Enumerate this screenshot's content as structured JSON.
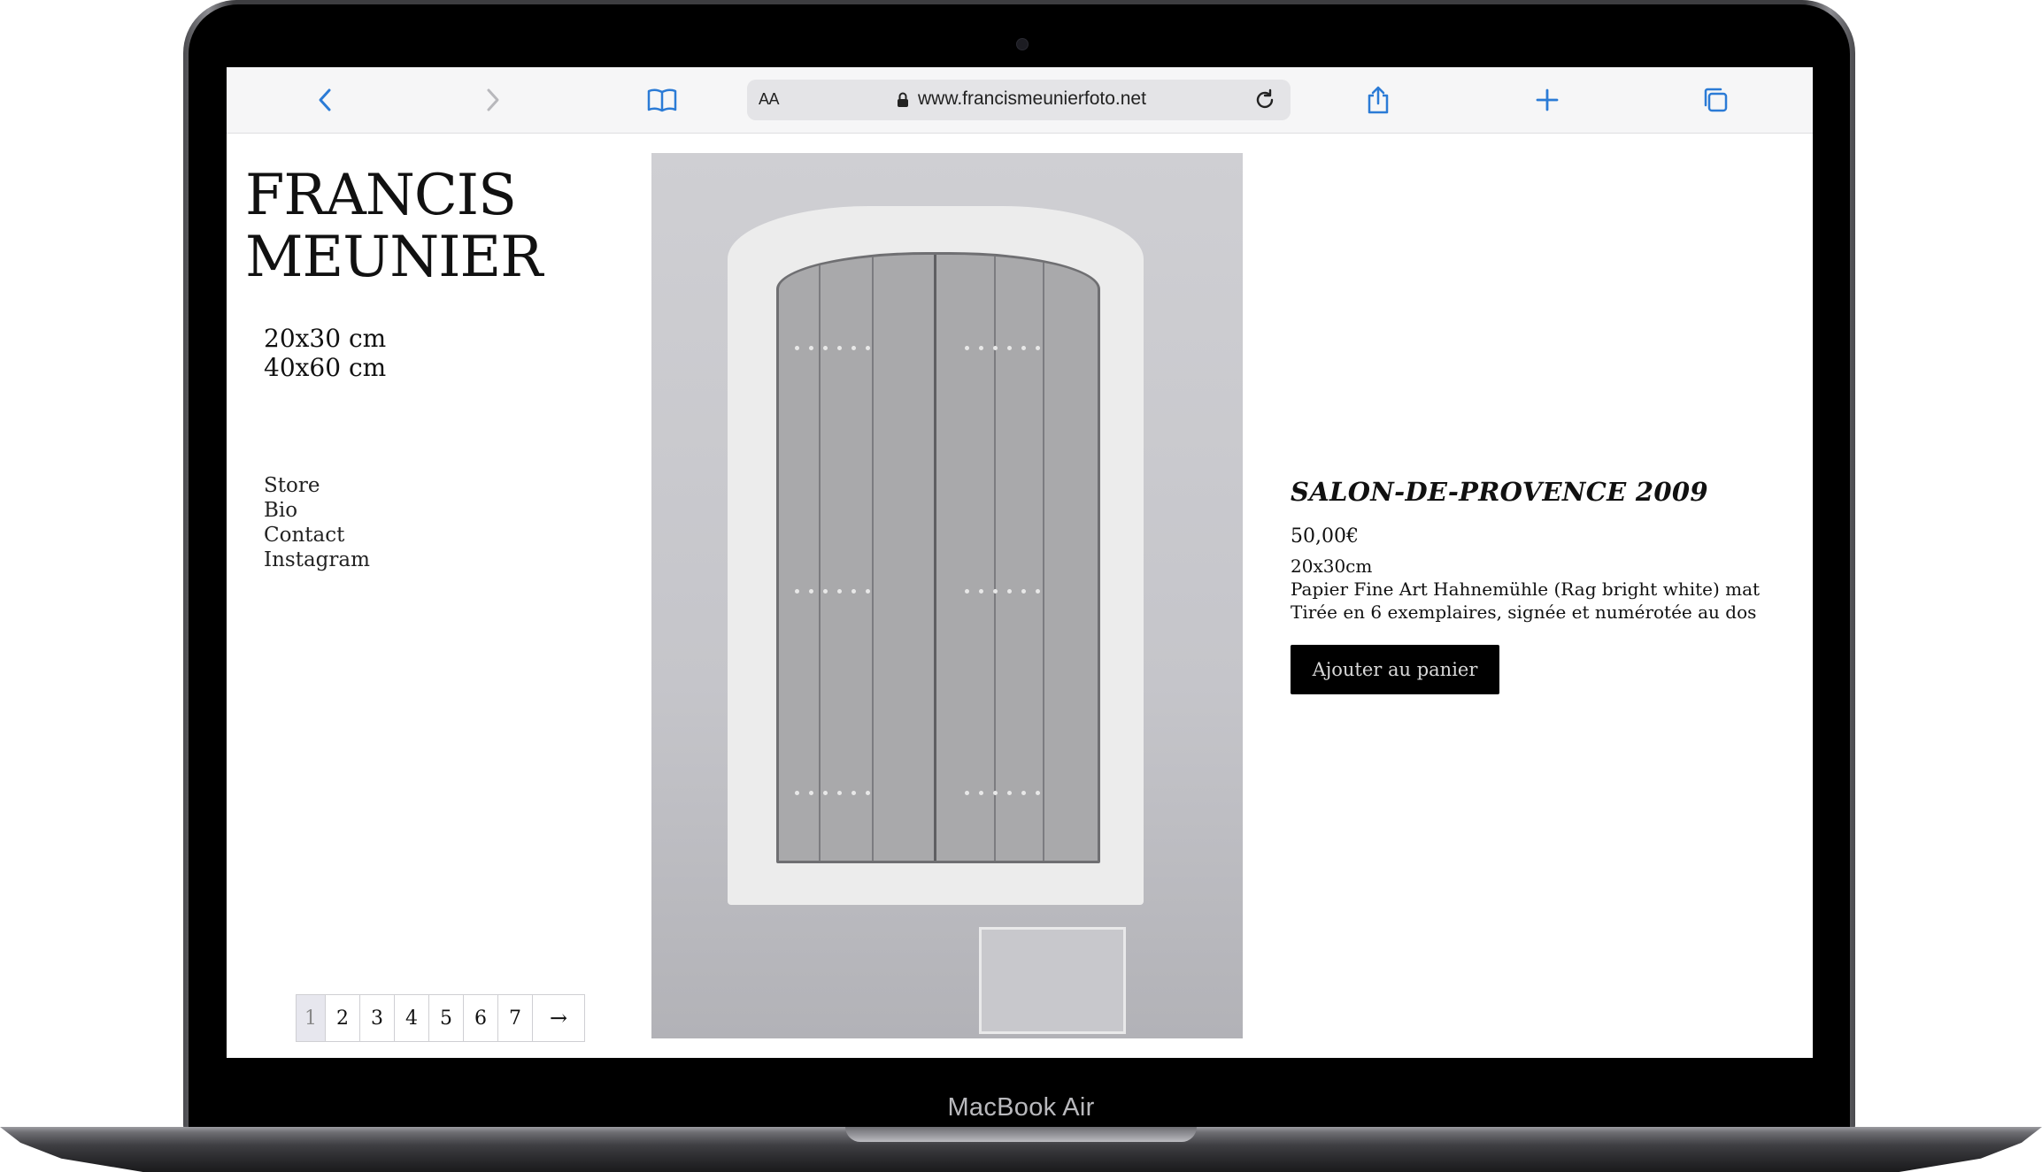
{
  "browser": {
    "url": "www.francismeunierfoto.net",
    "aa_label": "AA"
  },
  "site": {
    "title_line1": "FRANCIS",
    "title_line2": "MEUNIER",
    "sizes": [
      "20x30 cm",
      "40x60 cm"
    ],
    "nav": [
      "Store",
      "Bio",
      "Contact",
      "Instagram"
    ],
    "pagination": [
      "1",
      "2",
      "3",
      "4",
      "5",
      "6",
      "7",
      "→"
    ],
    "current_page": "1"
  },
  "product": {
    "title": "SALON-DE-PROVENCE 2009",
    "price": "50,00€",
    "format": "20x30cm",
    "paper": "Papier Fine Art Hahnemühle (Rag bright white) mat",
    "edition": "Tirée en 6 exemplaires, signée et numérotée au dos",
    "button": "Ajouter au panier"
  },
  "device": {
    "label": "MacBook Air"
  }
}
